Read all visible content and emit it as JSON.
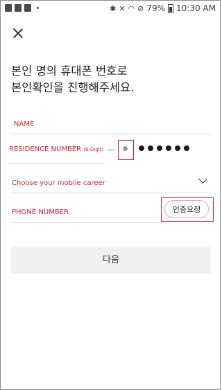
{
  "status_bar": {
    "battery": "79%",
    "time": "10:30 AM",
    "icons": [
      "gallery-icon",
      "puzzle-icon",
      "bag-icon",
      "bluetooth-icon",
      "mute-icon",
      "wifi-icon",
      "do-not-disturb-icon",
      "battery-icon"
    ]
  },
  "header": {
    "close_icon": "close-icon"
  },
  "headline": {
    "line1": "본인 명의 휴대폰 번호로",
    "line2": "본인확인을 진행해주세요."
  },
  "form": {
    "name_label": "NAME",
    "rrn_label": "RESIDENCE NUMBER",
    "rrn_sublabel": "(6-Digit)",
    "rrn_masked_count": 6,
    "carrier_placeholder": "Choose your mobile career",
    "phone_label": "PHONE NUMBER",
    "verify_button": "인증요청"
  },
  "next_button": "다음",
  "colors": {
    "accent": "#d0222f",
    "button_bg": "#f0f0f0"
  }
}
